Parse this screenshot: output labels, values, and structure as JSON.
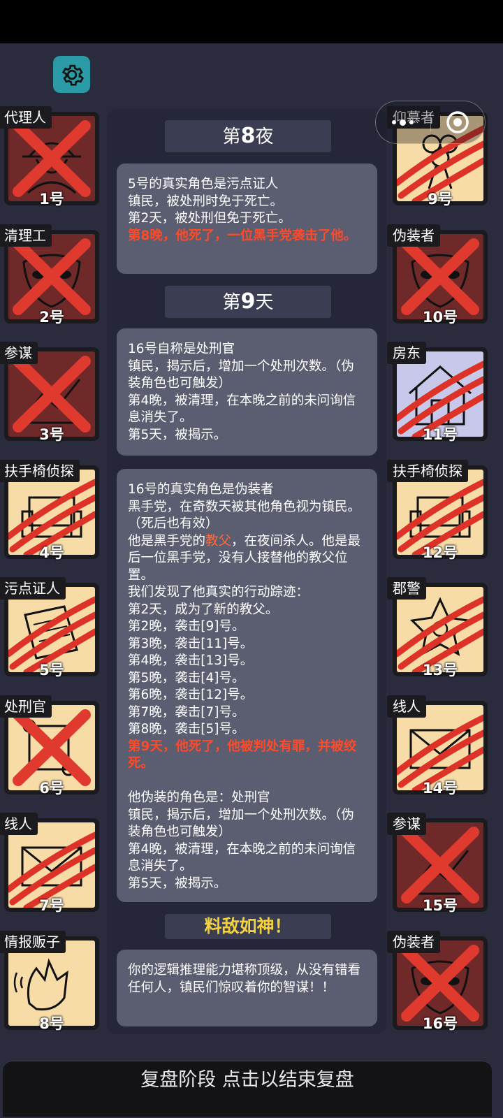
{
  "cards_left": [
    {
      "role": "代理人",
      "num": "1号",
      "status": "dead-x",
      "style": "dark",
      "icon": "detective-hat-icon"
    },
    {
      "role": "清理工",
      "num": "2号",
      "status": "dead-x",
      "style": "dark",
      "icon": "mask-icon"
    },
    {
      "role": "参谋",
      "num": "3号",
      "status": "dead-x",
      "style": "dark",
      "icon": "chart-icon"
    },
    {
      "role": "扶手椅侦探",
      "num": "4号",
      "status": "scratched",
      "style": "cream",
      "icon": "armchair-icon"
    },
    {
      "role": "污点证人",
      "num": "5号",
      "status": "scratched",
      "style": "cream",
      "icon": "papers-icon"
    },
    {
      "role": "处刑官",
      "num": "6号",
      "status": "dead-x",
      "style": "cream",
      "icon": "scroll-icon"
    },
    {
      "role": "线人",
      "num": "7号",
      "status": "scratched",
      "style": "cream",
      "icon": "envelope-icon"
    },
    {
      "role": "情报贩子",
      "num": "8号",
      "status": "alive",
      "style": "cream",
      "icon": "whisper-hand-icon"
    }
  ],
  "cards_right": [
    {
      "role": "仰慕者",
      "num": "9号",
      "status": "scratched",
      "style": "cream",
      "icon": "bouquet-icon"
    },
    {
      "role": "伪装者",
      "num": "10号",
      "status": "dead-x",
      "style": "dark",
      "icon": "mask-icon"
    },
    {
      "role": "房东",
      "num": "11号",
      "status": "scratched",
      "style": "lav",
      "icon": "house-icon"
    },
    {
      "role": "扶手椅侦探",
      "num": "12号",
      "status": "scratched",
      "style": "cream",
      "icon": "armchair-icon"
    },
    {
      "role": "郡警",
      "num": "13号",
      "status": "scratched",
      "style": "cream",
      "icon": "badge-icon"
    },
    {
      "role": "线人",
      "num": "14号",
      "status": "scratched",
      "style": "cream",
      "icon": "envelope-icon"
    },
    {
      "role": "参谋",
      "num": "15号",
      "status": "dead-x",
      "style": "dark",
      "icon": "chart-icon"
    },
    {
      "role": "伪装者",
      "num": "16号",
      "status": "dead-x",
      "style": "dark",
      "icon": "mask-icon"
    }
  ],
  "night_header": {
    "prefix": "第",
    "num": "8",
    "suffix": "夜"
  },
  "day_header": {
    "prefix": "第",
    "num": "9",
    "suffix": "天"
  },
  "msg1": {
    "l1": "5号的真实角色是污点证人",
    "l2": "镇民，被处刑时免于死亡。",
    "l3": "第2天，被处刑但免于死亡。",
    "l4": "第8晚，他死了，一位黑手党袭击了他。"
  },
  "msg2": {
    "l1": "16号自称是处刑官",
    "l2": "镇民，揭示后，增加一个处刑次数。（伪装角色也可触发）",
    "l3": "第4晚，被清理，在本晚之前的未问询信息消失了。",
    "l4": "第5天，被揭示。"
  },
  "msg3": {
    "l1": "16号的真实角色是伪装者",
    "l2": "黑手党，在奇数天被其他角色视为镇民。（死后也有效）",
    "l3a": "他是黑手党的",
    "l3b": "教父",
    "l3c": "，在夜间杀人。他是最后一位黑手党，没有人接替他的教父位置。",
    "l4": "我们发现了他真实的行动踪迹：",
    "l5": "第2天，成为了新的教父。",
    "l6": "第2晚，袭击[9]号。",
    "l7": "第3晚，袭击[11]号。",
    "l8": "第4晚，袭击[13]号。",
    "l9": "第5晚，袭击[4]号。",
    "l10": "第6晚，袭击[12]号。",
    "l11": "第7晚，袭击[7]号。",
    "l12": "第8晚，袭击[5]号。",
    "l13": "第9天，他死了，他被判处有罪，并被绞死。",
    "l14": "他伪装的角色是：处刑官",
    "l15": "镇民，揭示后，增加一个处刑次数。（伪装角色也可触发）",
    "l16": "第4晚，被清理，在本晚之前的未问询信息消失了。",
    "l17": "第5天，被揭示。"
  },
  "verdict_header": "料敌如神！",
  "msg4": "你的逻辑推理能力堪称顶级，从没有错看任何人，镇民们惊叹着你的智谋！！",
  "bottom_bar": "复盘阶段 点击以结束复盘",
  "colors": {
    "background": "#2a2c3e",
    "settings": "#2a9aa6",
    "card_cream": "#f7dca8",
    "card_dark": "#6f2929",
    "card_lavender": "#c8c8ea",
    "kill_red": "#e03a2e",
    "highlight_red": "#ff4a2a",
    "gold": "#f5d23a"
  }
}
